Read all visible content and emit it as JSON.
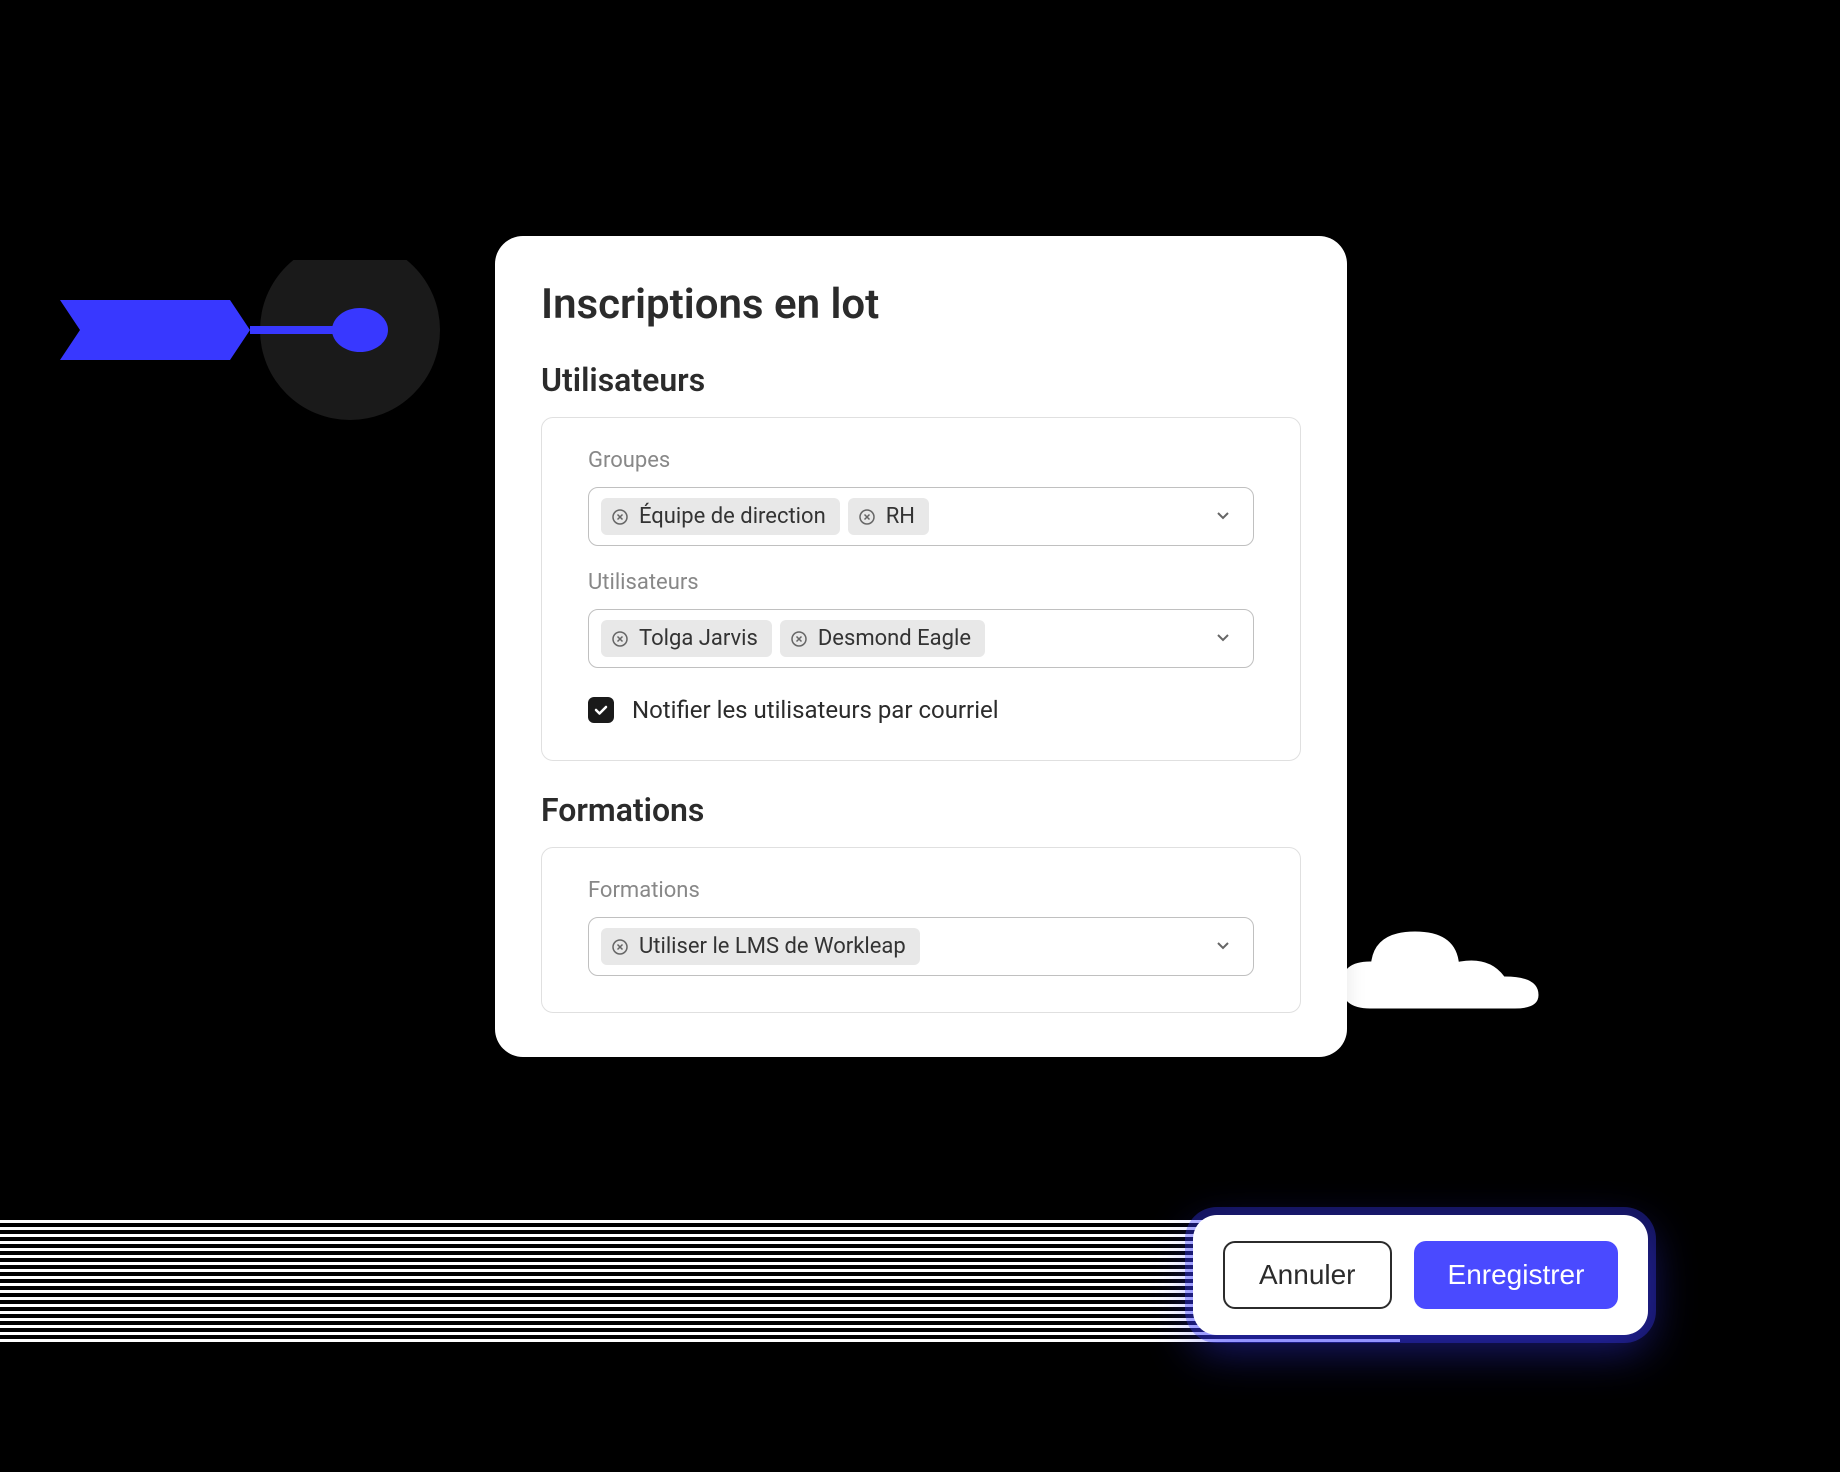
{
  "modal": {
    "title": "Inscriptions en lot",
    "users_section": {
      "title": "Utilisateurs",
      "groups_label": "Groupes",
      "groups": [
        "Équipe de direction",
        "RH"
      ],
      "users_label": "Utilisateurs",
      "users": [
        "Tolga Jarvis",
        "Desmond Eagle"
      ],
      "notify_checkbox": {
        "checked": true,
        "label": "Notifier les utilisateurs par courriel"
      }
    },
    "trainings_section": {
      "title": "Formations",
      "trainings_label": "Formations",
      "trainings": [
        "Utiliser le LMS de Workleap"
      ]
    }
  },
  "actions": {
    "cancel": "Annuler",
    "save": "Enregistrer"
  },
  "colors": {
    "primary": "#4a4aff",
    "text_dark": "#2b2b2b",
    "text_muted": "#888",
    "chip_bg": "#e8e8e8",
    "border": "#c0c0c0"
  }
}
